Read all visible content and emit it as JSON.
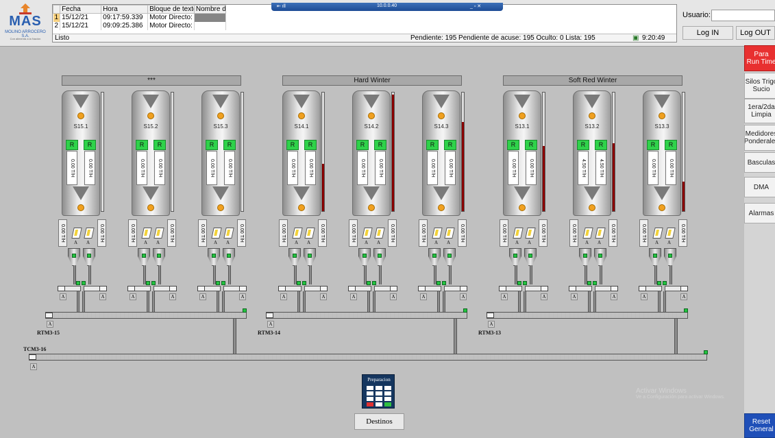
{
  "logo": {
    "brand": "MAS",
    "sub": "MOLINO ARROCERO S.A.",
    "tagline": "Con alimenta a la Nación"
  },
  "events": {
    "columns": [
      "",
      "Fecha",
      "Hora",
      "Bloque de texto",
      "Nombre de usu"
    ],
    "rows": [
      {
        "n": "1",
        "fecha": "15/12/21",
        "hora": "09:17:59.339",
        "bloque": "Motor Directo:",
        "usuario": ""
      },
      {
        "n": "2",
        "fecha": "15/12/21",
        "hora": "09:09:25.386",
        "bloque": "Motor Directo:",
        "usuario": ""
      }
    ],
    "status": "Listo",
    "summary": "Pendiente: 195  Pendiente de acuse: 195  Oculto: 0  Lista: 195",
    "time": "9:20:49"
  },
  "remote_bar": {
    "ip": "10.0.0.40",
    "left": "⇤  ıll",
    "right": "_  ▫  ✕"
  },
  "user": {
    "label": "Usuario:",
    "value": "",
    "login": "Log IN",
    "logout": "Log OUT"
  },
  "right_menu": [
    {
      "label": "Para\nRun Time",
      "color": "#e83030"
    },
    {
      "label": "Silos Trigo\nSucio",
      "color": "#f2f2f2"
    },
    {
      "label": "1era/2da\nLimpia",
      "color": "#f2f2f2"
    },
    {
      "label": "Medidores\nPonderales",
      "color": "#f2f2f2"
    },
    {
      "label": "Basculas",
      "color": "#f2f2f2"
    },
    {
      "label": "DMA",
      "color": "#f2f2f2"
    },
    {
      "label": "Alarmas",
      "color": "#f2f2f2"
    },
    {
      "label": "Reset\nGeneral",
      "color": "#1f4fb8"
    }
  ],
  "groups": [
    {
      "title": "***",
      "conveyor": "RTM3-15",
      "silos": [
        {
          "name": "S15.1",
          "r1": "R",
          "r2": "R",
          "v1": "0.00 T/H",
          "v2": "0.00 T/H",
          "o1": "0.00 T/H",
          "o2": "0.00 T/H",
          "gauge": 0
        },
        {
          "name": "S15.2",
          "r1": "R",
          "r2": "R",
          "v1": "0.00 T/H",
          "v2": "0.00 T/H",
          "o1": "0.00 T/H",
          "o2": "0.00 T/H",
          "gauge": 0
        },
        {
          "name": "S15.3",
          "r1": "R",
          "r2": "R",
          "v1": "0.00 T/H",
          "v2": "0.00 T/H",
          "o1": "0.00 T/H",
          "o2": "0.00 T/H",
          "gauge": 0
        }
      ]
    },
    {
      "title": "Hard Winter",
      "conveyor": "RTM3-14",
      "silos": [
        {
          "name": "S14.1",
          "r1": "R",
          "r2": "R",
          "v1": "0.00 T/H",
          "v2": "0.00 T/H",
          "o1": "0.00 T/H",
          "o2": "0.00 T/H",
          "gauge": 0.4
        },
        {
          "name": "S14.2",
          "r1": "R",
          "r2": "R",
          "v1": "0.00 T/H",
          "v2": "0.00 T/H",
          "o1": "0.00 T/H",
          "o2": "0.00 T/H",
          "gauge": 0.98
        },
        {
          "name": "S14.3",
          "r1": "R",
          "r2": "R",
          "v1": "0.00 T/H",
          "v2": "0.00 T/H",
          "o1": "0.00 T/H",
          "o2": "0.00 T/H",
          "gauge": 0.75
        }
      ]
    },
    {
      "title": "Soft Red Winter",
      "conveyor": "RTM3-13",
      "silos": [
        {
          "name": "S13.1",
          "r1": "R",
          "r2": "R",
          "v1": "0.00 T/H",
          "v2": "0.00 T/H",
          "o1": "0.00 T/H",
          "o2": "0.00 T/H",
          "gauge": 0.55
        },
        {
          "name": "S13.2",
          "r1": "R",
          "r2": "R",
          "v1": "4.50 T/H",
          "v2": "4.50 T/H",
          "o1": "0.00 T/H",
          "o2": "0.00 T/H",
          "gauge": 0.57
        },
        {
          "name": "S13.3",
          "r1": "R",
          "r2": "R",
          "v1": "0.00 T/H",
          "v2": "0.00 T/H",
          "o1": "0.00 T/H",
          "o2": "0.00 T/H",
          "gauge": 0.25
        }
      ]
    }
  ],
  "main_conveyor": "TCM3-16",
  "gate_letter": "A",
  "prep": {
    "label": "Preparacion",
    "icon": "grid-keypad-icon"
  },
  "destinos": "Destinos",
  "watermark": {
    "line1": "Activar Windows",
    "line2": "Ve a Configuración para activar Windows."
  }
}
